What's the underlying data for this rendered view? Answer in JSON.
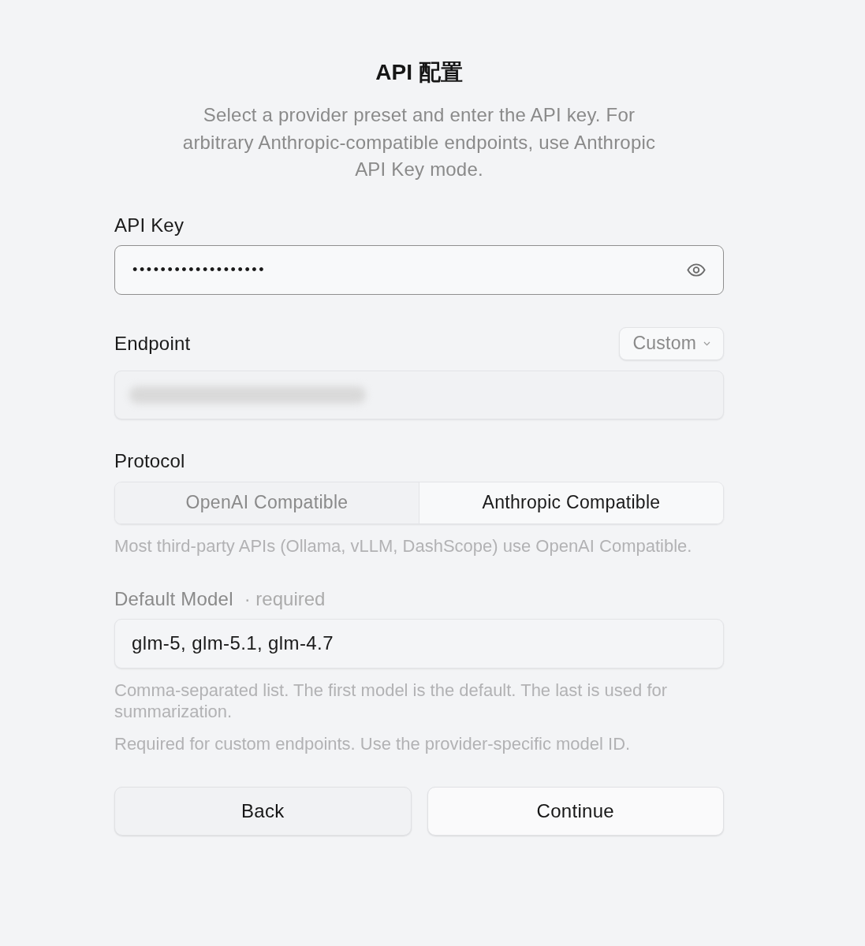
{
  "title": "API 配置",
  "description": "Select a provider preset and enter the API key. For arbitrary Anthropic-compatible endpoints, use Anthropic API Key mode.",
  "api_key": {
    "label": "API Key",
    "value": "•••••••••••••••••••"
  },
  "endpoint": {
    "label": "Endpoint",
    "preset": "Custom"
  },
  "protocol": {
    "label": "Protocol",
    "options": [
      {
        "label": "OpenAI Compatible",
        "selected": false
      },
      {
        "label": "Anthropic Compatible",
        "selected": true
      }
    ],
    "hint": "Most third-party APIs (Ollama, vLLM, DashScope) use OpenAI Compatible."
  },
  "default_model": {
    "label": "Default Model",
    "note": "· required",
    "value": "glm-5, glm-5.1, glm-4.7",
    "hints": [
      "Comma-separated list. The first model is the default. The last is used for summarization.",
      "Required for custom endpoints. Use the provider-specific model ID."
    ]
  },
  "buttons": [
    {
      "label": "Back",
      "kind": "secondary"
    },
    {
      "label": "Continue",
      "kind": "primary"
    }
  ]
}
